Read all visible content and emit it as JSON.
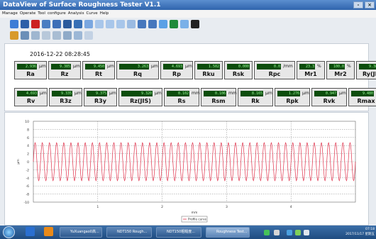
{
  "window": {
    "title": "DataView of Surface Roughness Tester  V1.1",
    "controls": [
      "-",
      "×"
    ]
  },
  "menu": [
    "Manage",
    "Operate",
    "Tool",
    "configure",
    "Analysis",
    "Curve",
    "Help"
  ],
  "datetime": "2016-12-22 08:28:45",
  "params_row1": [
    {
      "label": "Ra",
      "value": "2.936",
      "unit": "μm"
    },
    {
      "label": "Rz",
      "value": "9.385",
      "unit": "μm"
    },
    {
      "label": "Rt",
      "value": "9.450",
      "unit": "μm"
    },
    {
      "label": "Rq",
      "value": "3.263",
      "unit": "μm"
    },
    {
      "label": "Rp",
      "value": "4.693",
      "unit": "μm"
    },
    {
      "label": "Rku",
      "value": "1.502",
      "unit": ""
    },
    {
      "label": "Rsk",
      "value": "0.000",
      "unit": ""
    },
    {
      "label": "Rpc",
      "value": "0.0",
      "unit": "/mm"
    },
    {
      "label": "Mr1",
      "value": "23.3",
      "unit": "%"
    },
    {
      "label": "Mr2",
      "value": "100.0",
      "unit": "%"
    },
    {
      "label": "Ry(JIS)",
      "value": "9.385",
      "unit": "μm"
    }
  ],
  "params_row2": [
    {
      "label": "Rv",
      "value": "4.693",
      "unit": "μm"
    },
    {
      "label": "R3z",
      "value": "9.335",
      "unit": "μm"
    },
    {
      "label": "R3y",
      "value": "9.375",
      "unit": "μm"
    },
    {
      "label": "Rz(JIS)",
      "value": "9.320",
      "unit": "μm"
    },
    {
      "label": "Rs",
      "value": "0.102",
      "unit": "mm"
    },
    {
      "label": "Rsm",
      "value": "0.106",
      "unit": "mm"
    },
    {
      "label": "Rk",
      "value": "8.165",
      "unit": "μm"
    },
    {
      "label": "Rpk",
      "value": "1.276",
      "unit": "μm"
    },
    {
      "label": "Rvk",
      "value": "0.947",
      "unit": "μm"
    },
    {
      "label": "Rmax",
      "value": "9.480",
      "unit": "μm"
    }
  ],
  "chart_data": {
    "type": "line",
    "title": "",
    "xlabel": "mm",
    "ylabel": "μm",
    "xlim": [
      0,
      5
    ],
    "ylim": [
      -10,
      10
    ],
    "yticks": [
      "10",
      "8",
      "6",
      "4",
      "2",
      "0",
      "-2",
      "-4",
      "-6",
      "-8",
      "-10"
    ],
    "xticks": [
      "1",
      "2",
      "3",
      "4"
    ],
    "grid": true,
    "legend_position": "bottom-center",
    "series": [
      {
        "name": "Profile curve",
        "color": "#e0304a",
        "amplitude": 4.693,
        "cycles": 45
      }
    ]
  },
  "taskbar": {
    "apps": [
      "YuXuangao0高...",
      "NDT150 Rough...",
      "NDT150粗糙度...",
      "Roughness Test..."
    ],
    "clock_time": "07:18",
    "clock_date": "2017/11/17 星期五"
  }
}
